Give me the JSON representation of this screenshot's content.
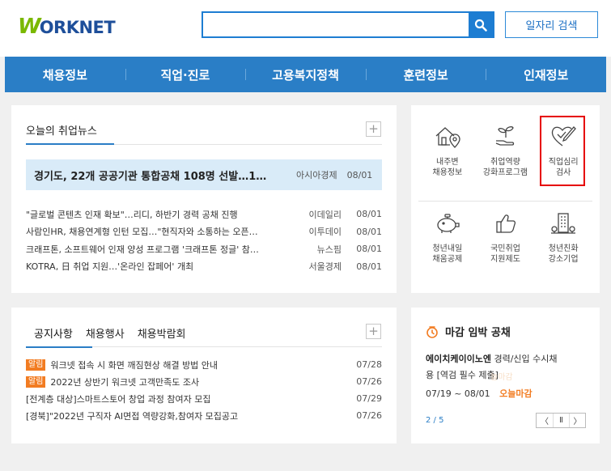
{
  "header": {
    "logo_w": "W",
    "logo_rest": "ORKNET",
    "search_placeholder": "",
    "job_search_label": "일자리 검색"
  },
  "nav": {
    "items": [
      "채용정보",
      "직업·진로",
      "고용복지정책",
      "훈련정보",
      "인재정보"
    ]
  },
  "news": {
    "title": "오늘의 취업뉴스",
    "headline": {
      "title": "경기도, 22개 공공기관 통합공채 108명 선발…1…",
      "source": "아시아경제",
      "date": "08/01"
    },
    "items": [
      {
        "title": "\"글로벌 콘텐츠 인재 확보\"…리디, 하반기 경력 공채 진행",
        "source": "이데일리",
        "date": "08/01"
      },
      {
        "title": "사람인HR, 채용연계형 인턴 모집…\"현직자와 소통하는 오픈…",
        "source": "이투데이",
        "date": "08/01"
      },
      {
        "title": "크래프톤, 소프트웨어 인재 양성 프로그램 '크래프톤 정글' 참…",
        "source": "뉴스핌",
        "date": "08/01"
      },
      {
        "title": "KOTRA, 日 취업 지원…'온라인 잡페어' 개최",
        "source": "서울경제",
        "date": "08/01"
      }
    ]
  },
  "quick_icons": {
    "row1": [
      {
        "label": "내주변\n채용정보",
        "icon": "house-location-icon"
      },
      {
        "label": "취업역량\n강화프로그램",
        "icon": "sprout-hand-icon"
      },
      {
        "label": "직업심리\n검사",
        "icon": "heart-check-pencil-icon"
      }
    ],
    "row2": [
      {
        "label": "청년내일\n채움공제",
        "icon": "piggy-bank-icon"
      },
      {
        "label": "국민취업\n지원제도",
        "icon": "thumbs-up-icon"
      },
      {
        "label": "청년친화\n강소기업",
        "icon": "building-icon"
      }
    ],
    "highlight_color": "#e60000"
  },
  "notice": {
    "tabs": [
      "공지사항",
      "채용행사",
      "채용박람회"
    ],
    "items": [
      {
        "badge": "알림",
        "title": "워크넷 접속 시 화면 깨짐현상 해결 방법 안내",
        "date": "07/28"
      },
      {
        "badge": "알림",
        "title": "2022년 상반기 워크넷 고객만족도 조사",
        "date": "07/26"
      },
      {
        "badge": "",
        "title": "[전계층 대상]스마트스토어 창업 과정 참여자 모집",
        "date": "07/29"
      },
      {
        "badge": "",
        "title": "[경북]\"2022년 구직자 AI면접 역량강화,참여자 모집공고",
        "date": "07/26"
      }
    ]
  },
  "deadline": {
    "title": "마감 임박 공채",
    "company": "에이치케이이노엔",
    "desc_line1": "경력/신입 수시채",
    "desc_line2": "용 [역검 필수 제출]",
    "ghost_text": "늘마감",
    "period": "07/19 ~ 08/01",
    "status": "오늘마감",
    "page": "2 / 5",
    "prev": "〈",
    "pause": "Ⅱ",
    "next": "〉"
  },
  "colors": {
    "primary": "#2a7ec6",
    "search_border": "#1d7dd2",
    "logo_green": "#7ab800",
    "logo_blue": "#1e4f9a",
    "accent_orange": "#f27c22",
    "headline_bg": "#d9ebf8"
  }
}
